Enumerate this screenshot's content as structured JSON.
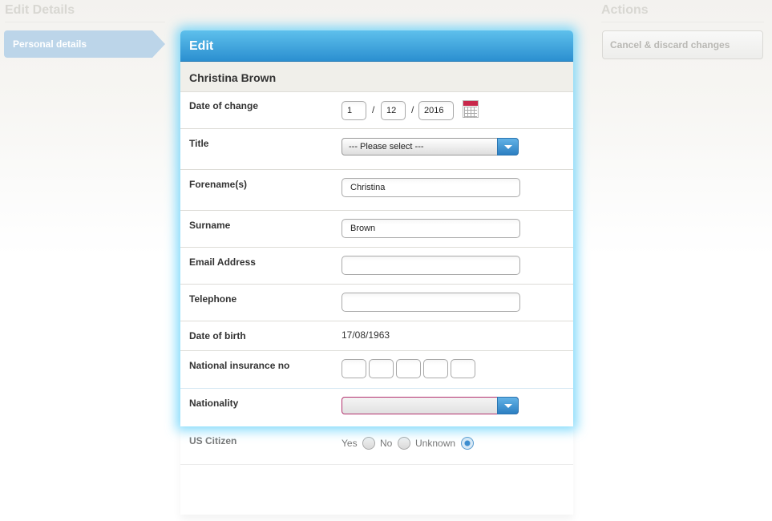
{
  "left_section": {
    "title": "Edit Details",
    "nav_item": "Personal details"
  },
  "right_section": {
    "title": "Actions",
    "cancel_button": "Cancel & discard changes"
  },
  "panel": {
    "header": "Edit",
    "person_name": "Christina Brown",
    "date_of_change": {
      "label": "Date of change",
      "day": "1",
      "month": "12",
      "year": "2016",
      "separator": "/"
    },
    "title": {
      "label": "Title",
      "selected": "--- Please select ---"
    },
    "forename": {
      "label": "Forename(s)",
      "value": "Christina"
    },
    "surname": {
      "label": "Surname",
      "value": "Brown"
    },
    "email": {
      "label": "Email Address",
      "value": ""
    },
    "telephone": {
      "label": "Telephone",
      "value": ""
    },
    "dob": {
      "label": "Date of birth",
      "value": "17/08/1963"
    },
    "ni": {
      "label": "National insurance no"
    },
    "nationality": {
      "label": "Nationality",
      "selected": ""
    },
    "us_citizen": {
      "label": "US Citizen",
      "options": [
        "Yes",
        "No",
        "Unknown"
      ],
      "selected": "Unknown"
    }
  },
  "colors": {
    "header_blue": "#2b8fd0",
    "invalid_border": "#b3326e",
    "glow": "#5acdfa"
  }
}
